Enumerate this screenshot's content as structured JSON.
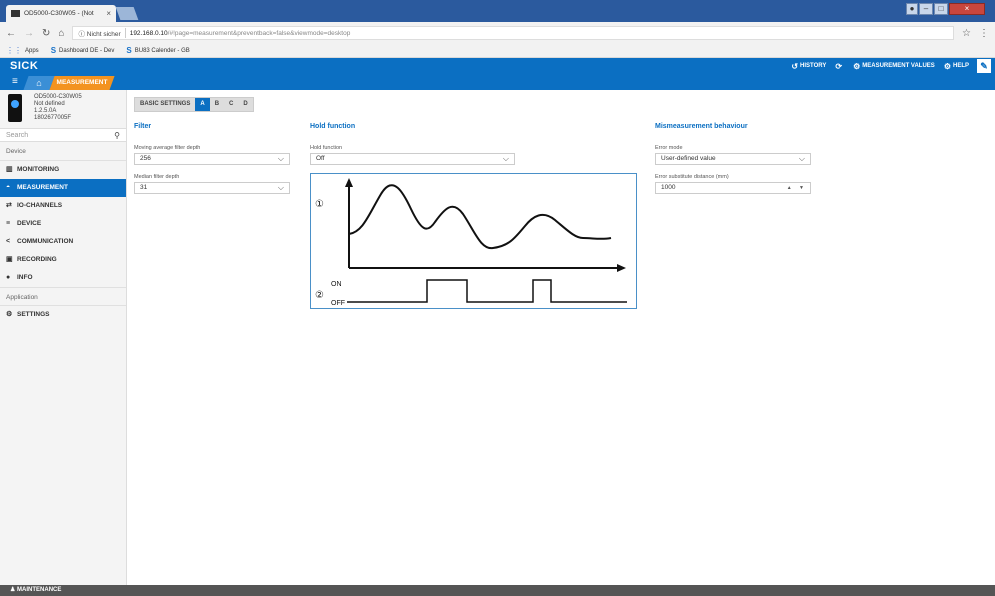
{
  "browser": {
    "tab_title": "OD5000-C30W05 - (Not",
    "tab_close": "×",
    "secure_label": "ⓘ Nicht sicher",
    "url_host": "192.168.0.10",
    "url_path": "/#!page=measurement&preventback=false&viewmode=desktop",
    "bookmarks": [
      {
        "label": "Apps",
        "icon": "apps-grid-icon"
      },
      {
        "label": "Dashboard DE - Dev",
        "icon": "sick-s-icon"
      },
      {
        "label": "BU83 Calender - GB",
        "icon": "sick-s-icon"
      }
    ]
  },
  "header": {
    "logo": "SICK",
    "history": "HISTORY",
    "measurement_values": "MEASUREMENT VALUES",
    "help": "HELP"
  },
  "nav": {
    "measurement_tab": "MEASUREMENT"
  },
  "device": {
    "model": "OD5000-C30W05",
    "name": "Not defined",
    "version": "1.2.5.0A",
    "serial": "1802677005F"
  },
  "sidebar": {
    "search_placeholder": "Search",
    "device_section": "Device",
    "items": [
      {
        "label": "MONITORING",
        "icon": "bar-chart-icon",
        "glyph": "▥",
        "active": false
      },
      {
        "label": "MEASUREMENT",
        "icon": "gauge-icon",
        "glyph": "◓",
        "active": true
      },
      {
        "label": "IO-CHANNELS",
        "icon": "arrows-icon",
        "glyph": "⇄",
        "active": false
      },
      {
        "label": "DEVICE",
        "icon": "list-icon",
        "glyph": "≡",
        "active": false
      },
      {
        "label": "COMMUNICATION",
        "icon": "share-icon",
        "glyph": "<",
        "active": false
      },
      {
        "label": "RECORDING",
        "icon": "save-icon",
        "glyph": "▣",
        "active": false
      },
      {
        "label": "INFO",
        "icon": "info-icon",
        "glyph": "●",
        "active": false
      }
    ],
    "application_section": "Application",
    "settings": {
      "label": "SETTINGS",
      "icon": "gears-icon",
      "glyph": "⚙"
    }
  },
  "tabs": [
    "BASIC SETTINGS",
    "A",
    "B",
    "C",
    "D"
  ],
  "active_tab": "A",
  "filter": {
    "title": "Filter",
    "moving_label": "Moving average filter depth",
    "moving_value": "256",
    "median_label": "Median filter depth",
    "median_value": "31"
  },
  "hold": {
    "title": "Hold function",
    "label": "Hold function",
    "value": "Off",
    "diagram": {
      "marker1": "①",
      "marker2": "②",
      "on": "ON",
      "off": "OFF"
    }
  },
  "mismeasure": {
    "title": "Mismeasurement behaviour",
    "error_mode_label": "Error mode",
    "error_mode_value": "User-defined value",
    "subst_label": "Error substitute distance (mm)",
    "subst_value": "1000"
  },
  "footer": {
    "label": "MAINTENANCE"
  },
  "colors": {
    "brand_blue": "#0b6fc2",
    "accent_orange": "#f39320"
  }
}
